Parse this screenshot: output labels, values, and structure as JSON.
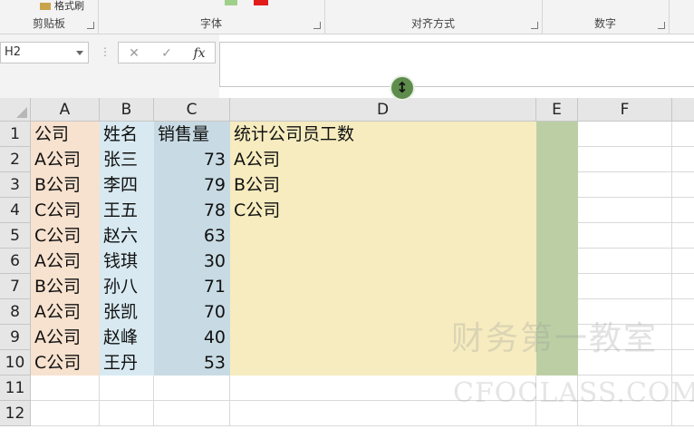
{
  "ribbon": {
    "format_painter_label": "格式刷",
    "groups": [
      {
        "label": "剪贴板"
      },
      {
        "label": "字体"
      },
      {
        "label": "对齐方式"
      },
      {
        "label": "数字"
      }
    ]
  },
  "formula_bar": {
    "name_box": "H2",
    "dots": "⋮",
    "cancel_icon": "✕",
    "enter_icon": "✓",
    "fx_label": "fx",
    "formula": ""
  },
  "columns": [
    "A",
    "B",
    "C",
    "D",
    "E",
    "F"
  ],
  "rows": [
    "1",
    "2",
    "3",
    "4",
    "5",
    "6",
    "7",
    "8",
    "9",
    "10",
    "11",
    "12"
  ],
  "table": [
    [
      "公司",
      "姓名",
      "销售量",
      "统计公司员工数"
    ],
    [
      "A公司",
      "张三",
      "73",
      "A公司"
    ],
    [
      "B公司",
      "李四",
      "79",
      "B公司"
    ],
    [
      "C公司",
      "王五",
      "78",
      "C公司"
    ],
    [
      "C公司",
      "赵六",
      "63",
      ""
    ],
    [
      "A公司",
      "钱琪",
      "30",
      ""
    ],
    [
      "B公司",
      "孙八",
      "71",
      ""
    ],
    [
      "A公司",
      "张凯",
      "70",
      ""
    ],
    [
      "A公司",
      "赵峰",
      "40",
      ""
    ],
    [
      "C公司",
      "王丹",
      "53",
      ""
    ]
  ],
  "colors": {
    "col_a_fill": "#f7e2cf",
    "col_b_fill": "#d8e9f1",
    "col_c_fill": "#c8dbe4",
    "col_d_fill": "#f6ecbf",
    "col_e_fill": "#bccfa4",
    "accent": "#217346"
  },
  "selected_cell": "H2",
  "watermark": {
    "line1": "财务第一教室",
    "line2": "CFOCLASS.COM"
  }
}
